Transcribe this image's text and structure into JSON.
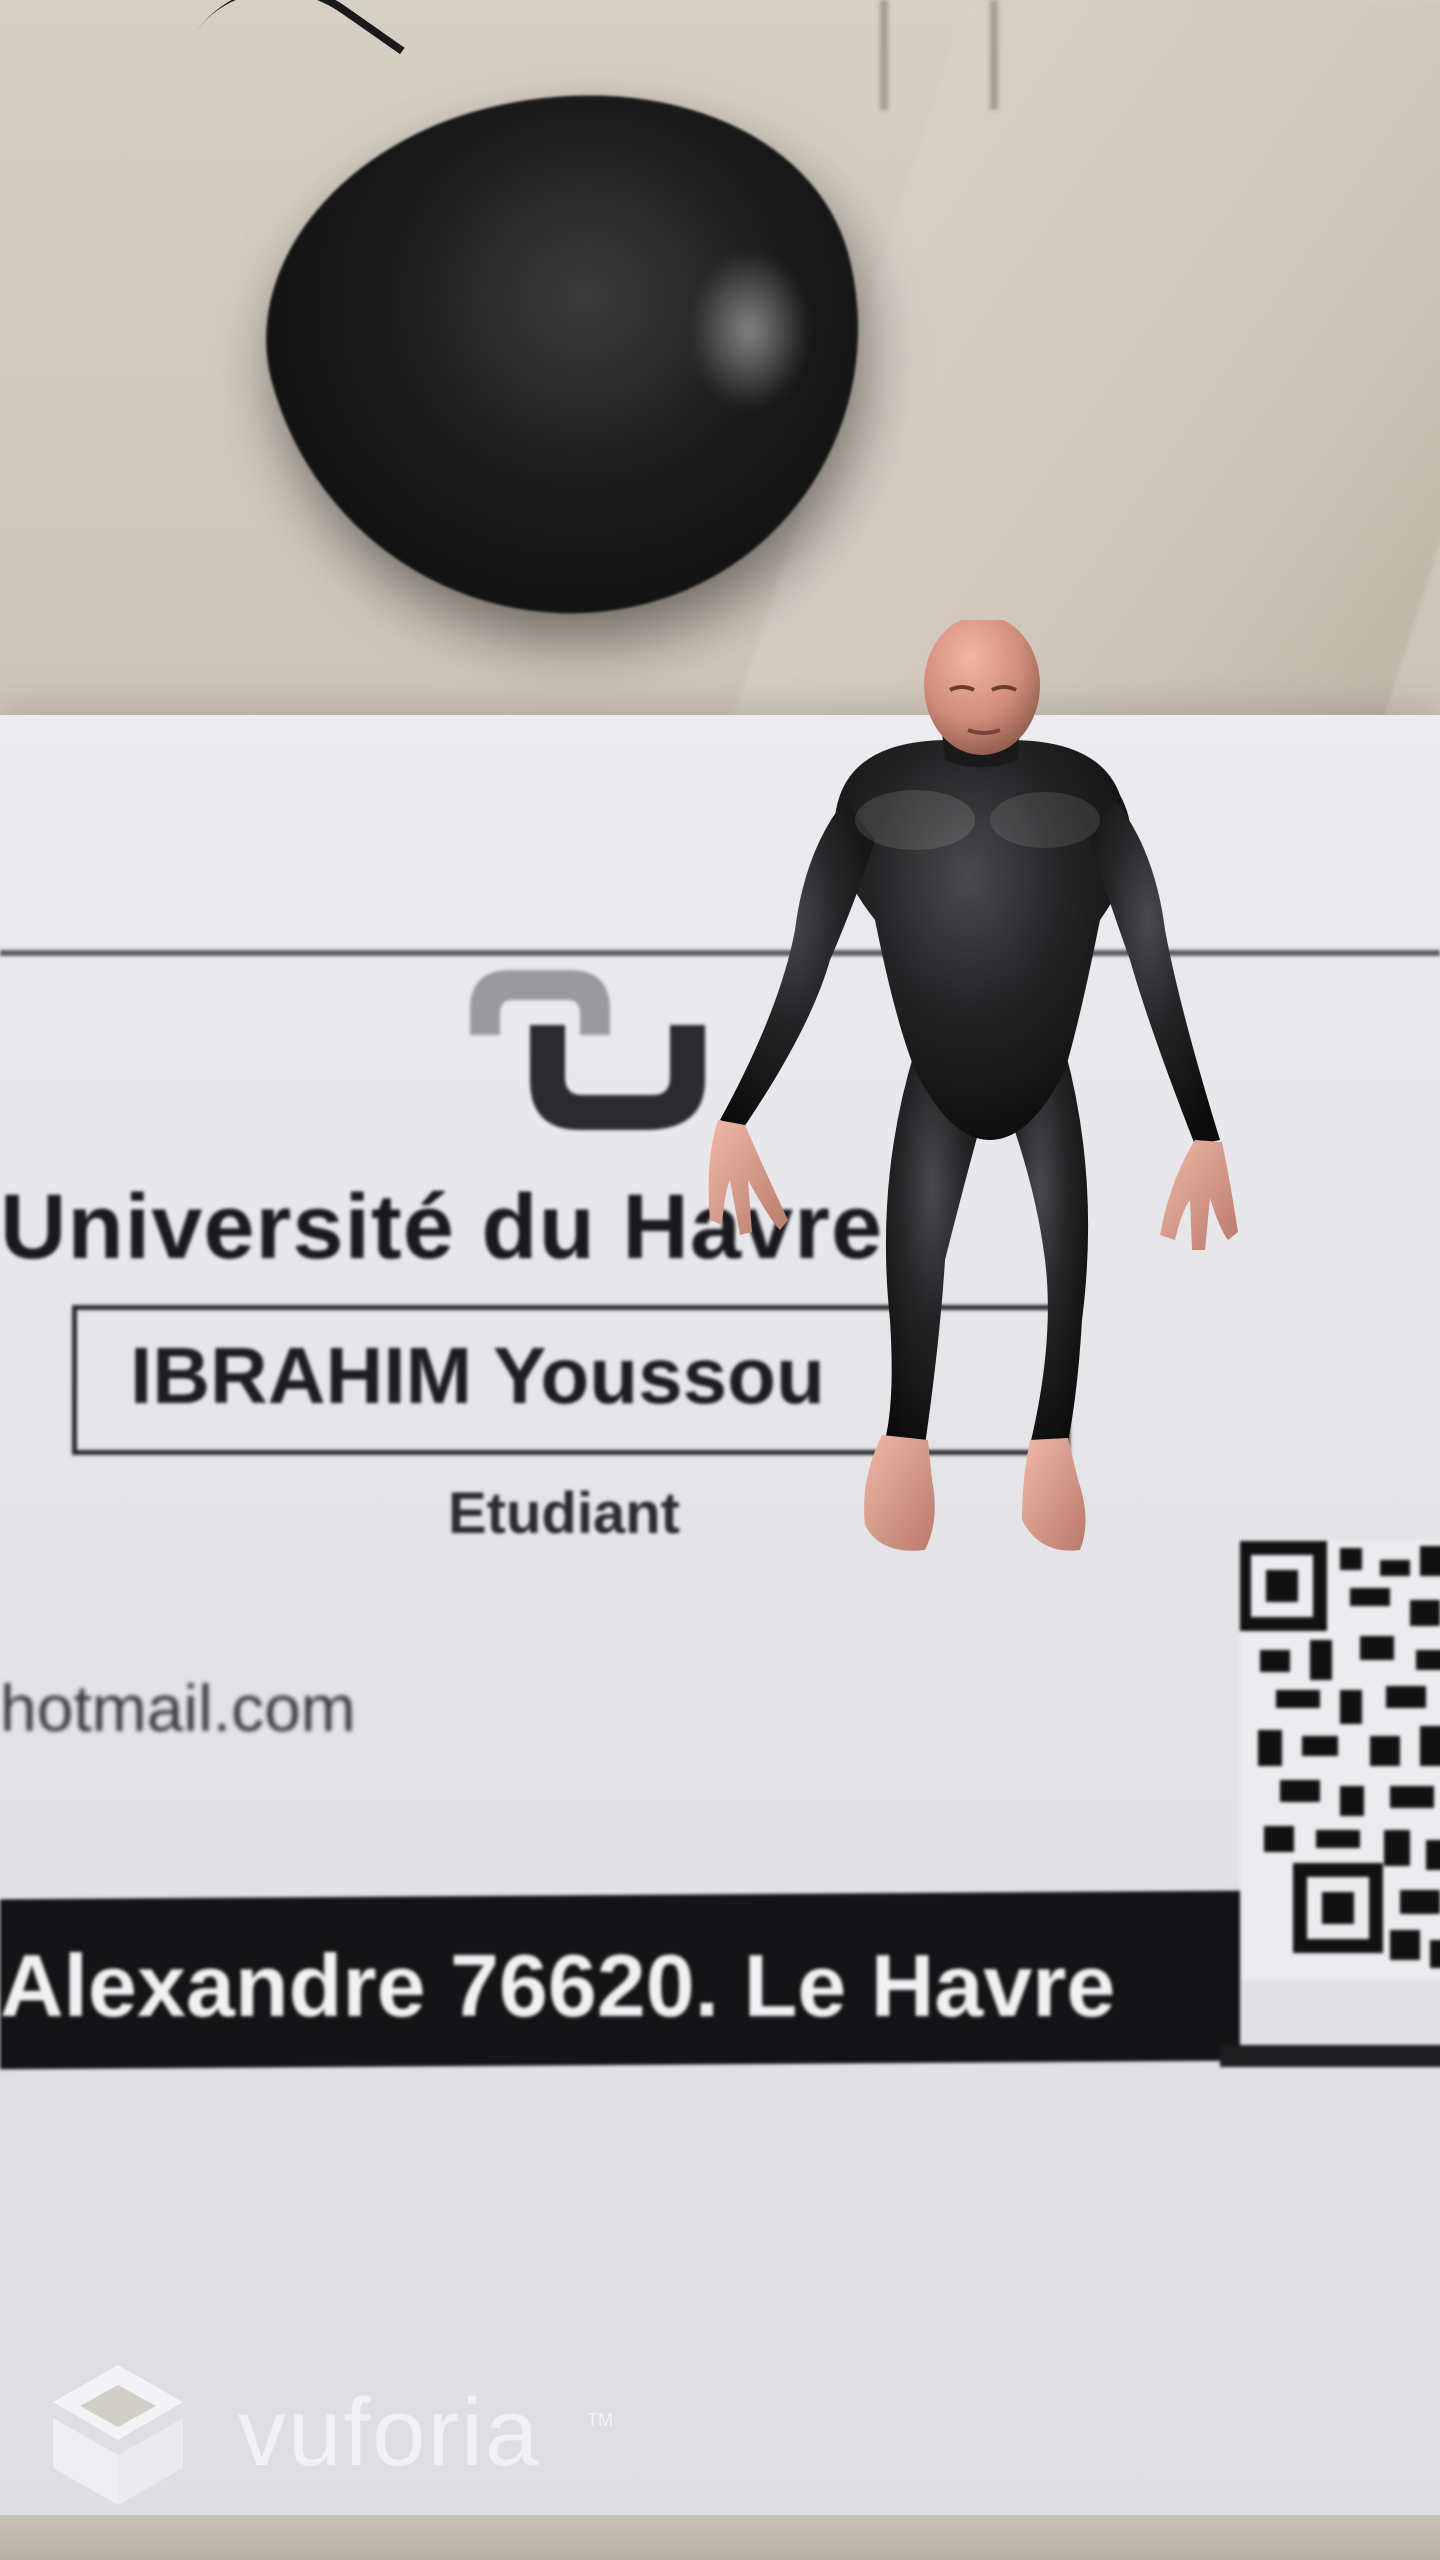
{
  "card": {
    "university": "Université du Havre",
    "name": "IBRAHIM Youssou",
    "role": "Etudiant",
    "email_fragment": "hotmail.com",
    "address": "Alexandre 76620. Le Havre"
  },
  "watermark": {
    "brand": "vuforia",
    "trademark": "TM"
  },
  "icons": {
    "university_logo": "university-logo-icon",
    "qr_code": "qr-code-icon",
    "vuforia_logo": "vuforia-cube-icon"
  },
  "colors": {
    "card": "#e7e6ea",
    "ink": "#1a1a1d",
    "watermark": "#f3f3f5"
  }
}
